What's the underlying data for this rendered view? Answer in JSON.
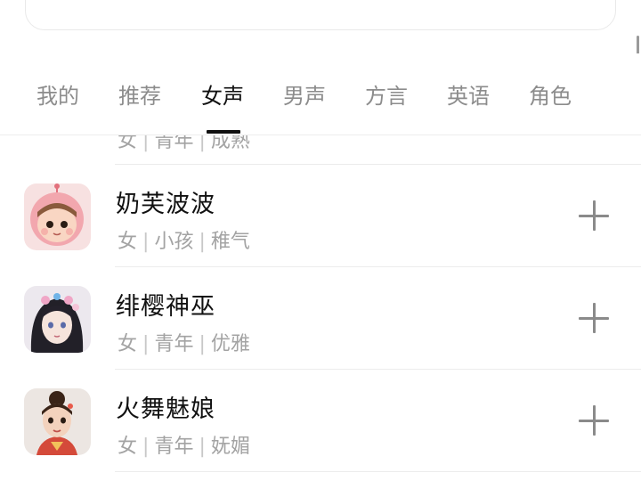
{
  "tabs": [
    {
      "label": "我的"
    },
    {
      "label": "推荐"
    },
    {
      "label": "女声",
      "active": true
    },
    {
      "label": "男声"
    },
    {
      "label": "方言"
    },
    {
      "label": "英语"
    },
    {
      "label": "角色"
    }
  ],
  "voices": [
    {
      "name": "",
      "gender": "女",
      "age": "青年",
      "style": "成熟",
      "avatar_icon": "blue-character-avatar-icon"
    },
    {
      "name": "奶芙波波",
      "gender": "女",
      "age": "小孩",
      "style": "稚气",
      "avatar_icon": "pink-baby-avatar-icon"
    },
    {
      "name": "绯樱神巫",
      "gender": "女",
      "age": "青年",
      "style": "优雅",
      "avatar_icon": "shrine-maiden-avatar-icon"
    },
    {
      "name": "火舞魅娘",
      "gender": "女",
      "age": "青年",
      "style": "妩媚",
      "avatar_icon": "dancer-girl-avatar-icon"
    }
  ],
  "colors": {
    "accent": "#111111",
    "muted": "#a3a3a3",
    "divider": "#ececec"
  }
}
